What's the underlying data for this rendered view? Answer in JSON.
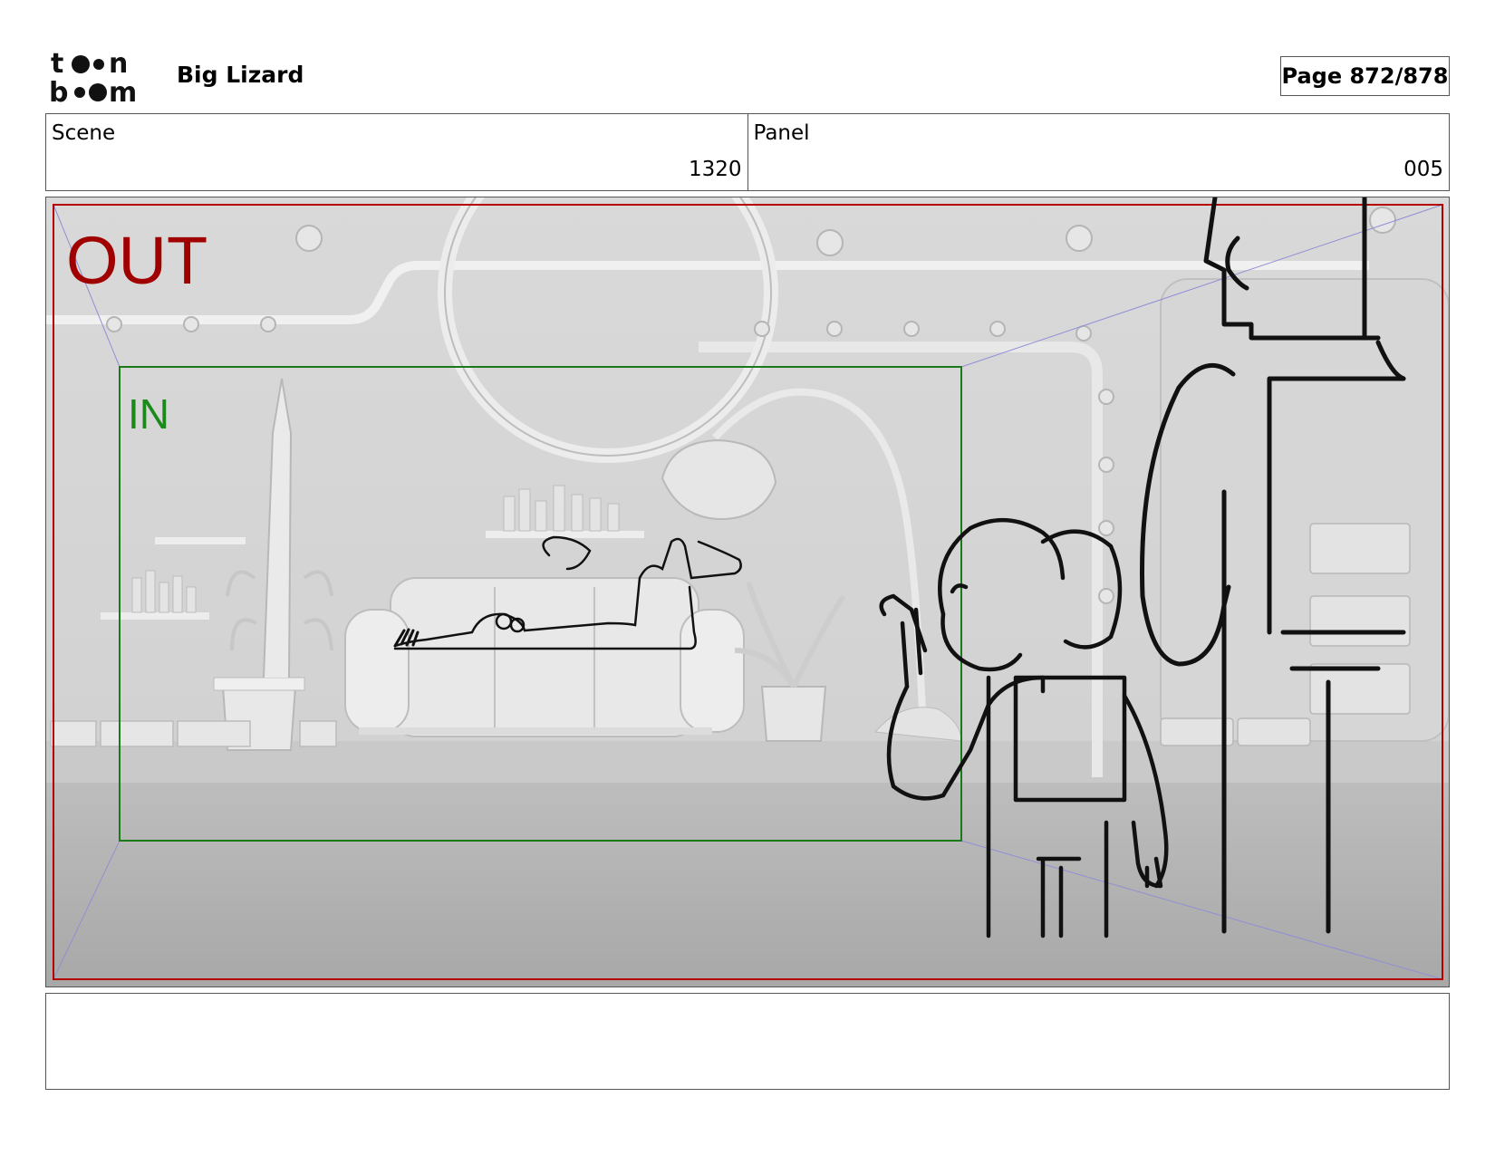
{
  "header": {
    "logo_text_top": "toon",
    "logo_text_bottom": "boom",
    "project_title": "Big Lizard",
    "page_label": "Page 872/878"
  },
  "info": {
    "scene_label": "Scene",
    "scene_value": "1320",
    "panel_label": "Panel",
    "panel_value": "005"
  },
  "frame": {
    "out_label": "OUT",
    "in_label": "IN",
    "out_color": "#a00000",
    "in_color": "#1b8a1b"
  },
  "caption": {
    "text": ""
  }
}
